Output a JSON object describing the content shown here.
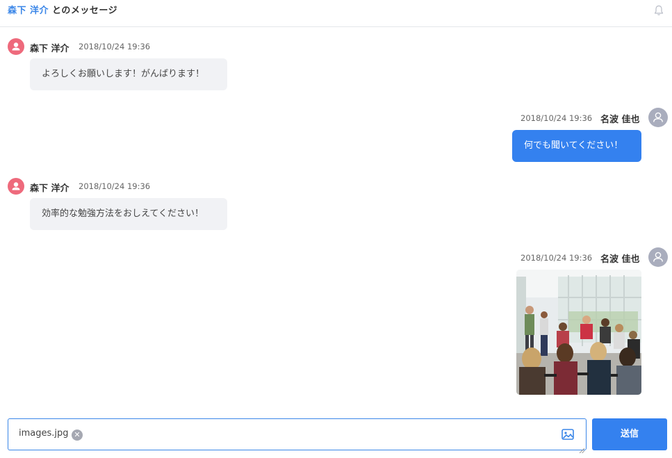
{
  "header": {
    "partner_name": "森下 洋介",
    "title_suffix": " とのメッセージ",
    "notification_icon": "bell-icon"
  },
  "messages": [
    {
      "side": "left",
      "sender": "森下 洋介",
      "time": "2018/10/24  19:36",
      "text": "よろしくお願いします！がんばります！",
      "avatar_color": "#ee6a7c"
    },
    {
      "side": "right",
      "sender": "名波 佳也",
      "time": "2018/10/24  19:36",
      "text": "何でも聞いてください！",
      "avatar_color": "#a9adbd"
    },
    {
      "side": "left",
      "sender": "森下 洋介",
      "time": "2018/10/24  19:36",
      "text": "効率的な勉強方法をおしえてください！",
      "avatar_color": "#ee6a7c"
    },
    {
      "side": "right",
      "sender": "名波 佳也",
      "time": "2018/10/24  19:36",
      "attachment": "classroom photo"
    }
  ],
  "composer": {
    "attachment_name": "images.jpg",
    "clear_icon": "close-icon",
    "image_icon": "image-icon",
    "send_label": "送信"
  },
  "colors": {
    "accent": "#3481ef",
    "left_avatar": "#ee6a7c",
    "right_avatar": "#a9adbd",
    "left_bubble": "#f1f2f5"
  }
}
